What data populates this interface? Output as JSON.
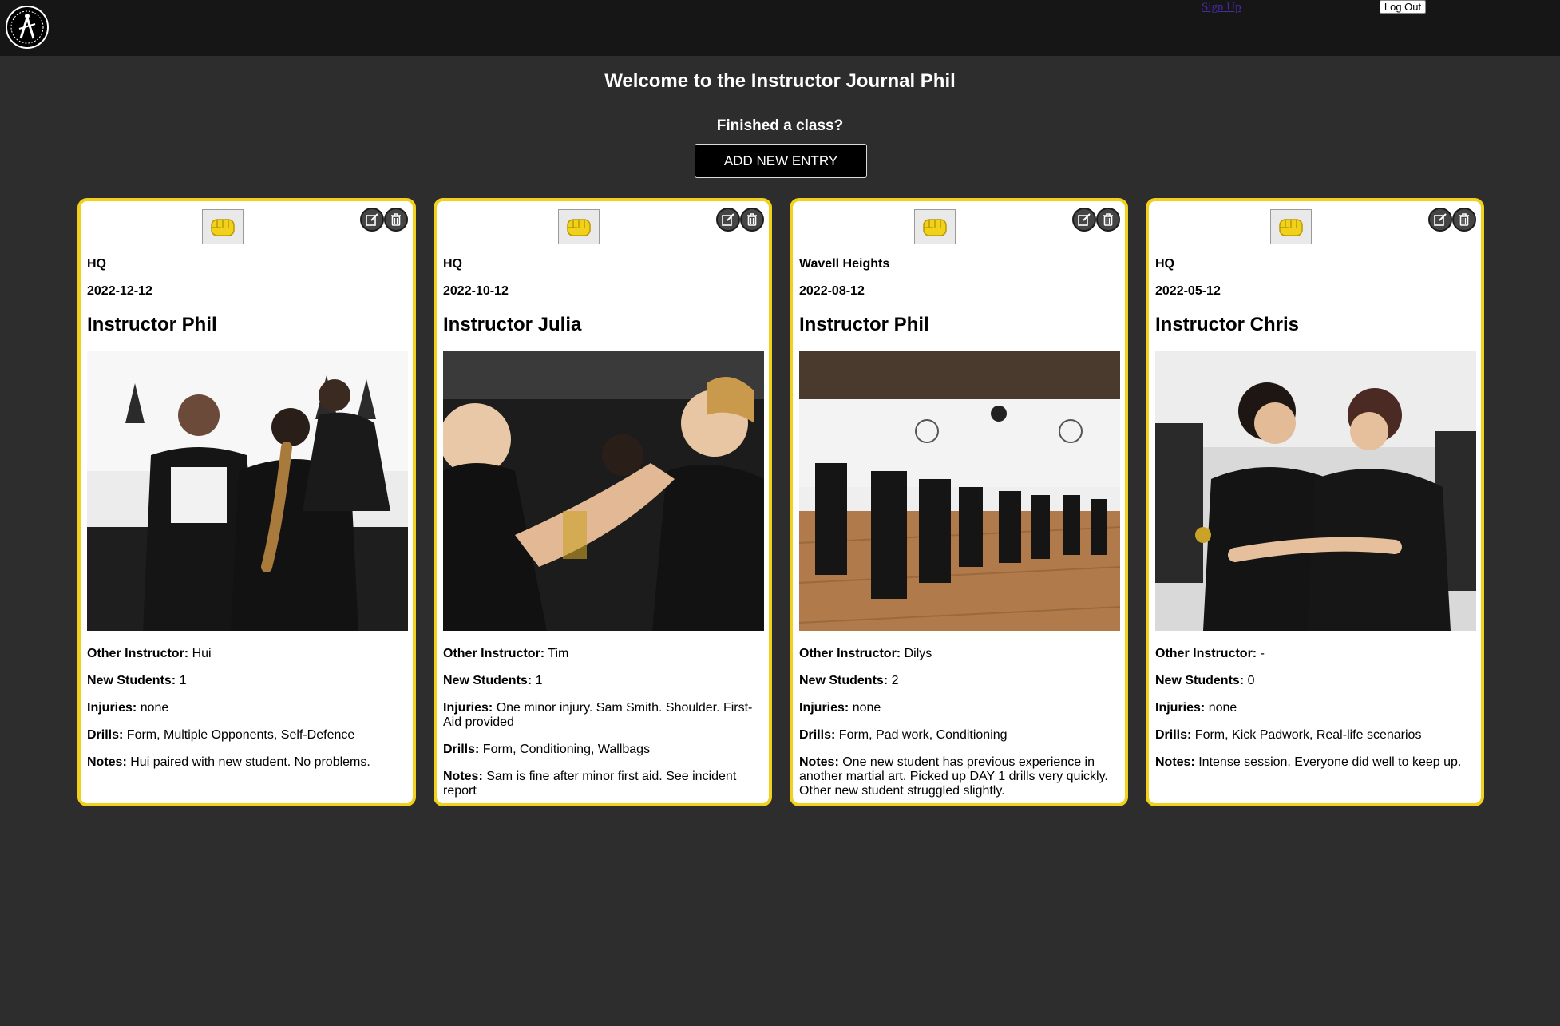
{
  "header": {
    "logo_icon": "school-logo-icon",
    "signup_label": "Sign Up",
    "logout_label": "Log Out"
  },
  "welcome": {
    "title": "Welcome to the Instructor Journal Phil",
    "prompt": "Finished a class?",
    "add_button": "ADD NEW ENTRY"
  },
  "labels": {
    "other_instructor": "Other Instructor:",
    "new_students": "New Students:",
    "injuries": "Injuries:",
    "drills": "Drills:",
    "notes": "Notes:"
  },
  "colors": {
    "accent": "#f1d11b",
    "page_bg": "#2d2d2d",
    "topbar_bg": "#161616"
  },
  "entries": [
    {
      "location": "HQ",
      "date": "2022-12-12",
      "instructor": "Instructor Phil",
      "other_instructor": "Hui",
      "new_students": "1",
      "injuries": "none",
      "drills": "Form, Multiple Opponents, Self-Defence",
      "notes": "Hui paired with new student. No problems."
    },
    {
      "location": "HQ",
      "date": "2022-10-12",
      "instructor": "Instructor Julia",
      "other_instructor": "Tim",
      "new_students": "1",
      "injuries": "One minor injury. Sam Smith. Shoulder. First-Aid provided",
      "drills": "Form, Conditioning, Wallbags",
      "notes": "Sam is fine after minor first aid. See incident report"
    },
    {
      "location": "Wavell Heights",
      "date": "2022-08-12",
      "instructor": "Instructor Phil",
      "other_instructor": "Dilys",
      "new_students": "2",
      "injuries": "none",
      "drills": "Form, Pad work, Conditioning",
      "notes": "One new student has previous experience in another martial art. Picked up DAY 1 drills very quickly. Other new student struggled slightly."
    },
    {
      "location": "HQ",
      "date": "2022-05-12",
      "instructor": "Instructor Chris",
      "other_instructor": "-",
      "new_students": "0",
      "injuries": "none",
      "drills": "Form, Kick Padwork, Real-life scenarios",
      "notes": "Intense session. Everyone did well to keep up."
    }
  ]
}
